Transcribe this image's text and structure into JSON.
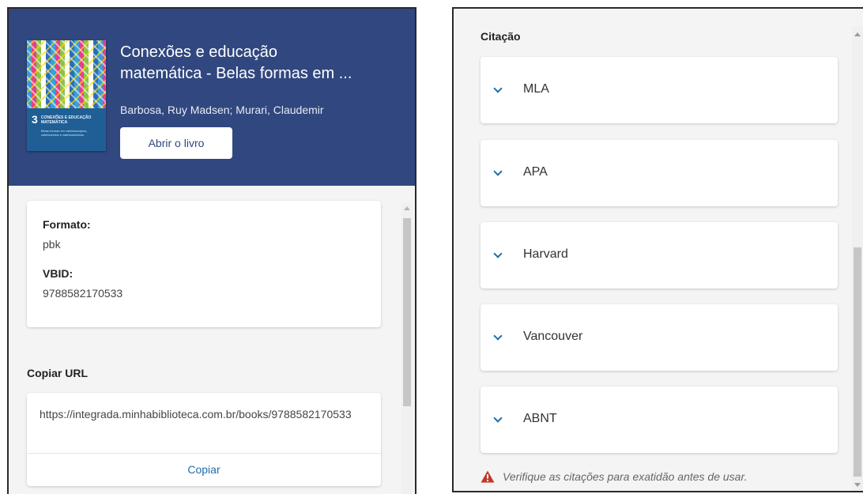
{
  "book": {
    "title_line1": "Conexões e educação",
    "title_line2": "matemática - Belas formas em ...",
    "authors": "Barbosa, Ruy Madsen; Murari, Claudemir",
    "open_button_label": "Abrir o livro",
    "cover": {
      "number": "3",
      "title_text": "CONEXÕES E EDUCAÇÃO MATEMÁTICA",
      "subtitle_text": "Belas formas em caleidoscópios, caleidociclos e caleidostrótons"
    }
  },
  "details": {
    "format_label": "Formato:",
    "format_value": "pbk",
    "vbid_label": "VBID:",
    "vbid_value": "9788582170533"
  },
  "copy_url": {
    "heading": "Copiar URL",
    "url": "https://integrada.minhabiblioteca.com.br/books/9788582170533",
    "copy_button_label": "Copiar"
  },
  "citation": {
    "heading": "Citação",
    "items": [
      {
        "label": "MLA"
      },
      {
        "label": "APA"
      },
      {
        "label": "Harvard"
      },
      {
        "label": "Vancouver"
      },
      {
        "label": "ABNT"
      }
    ],
    "warning": "Verifique as citações para exatidão antes de usar."
  },
  "colors": {
    "header_blue": "#31477f",
    "link_blue": "#1f6fa8",
    "warning_red": "#c0392b",
    "panel_gray": "#f4f4f4"
  },
  "icons": {
    "expand": "chevron-down-icon",
    "warning": "warning-triangle-icon"
  }
}
